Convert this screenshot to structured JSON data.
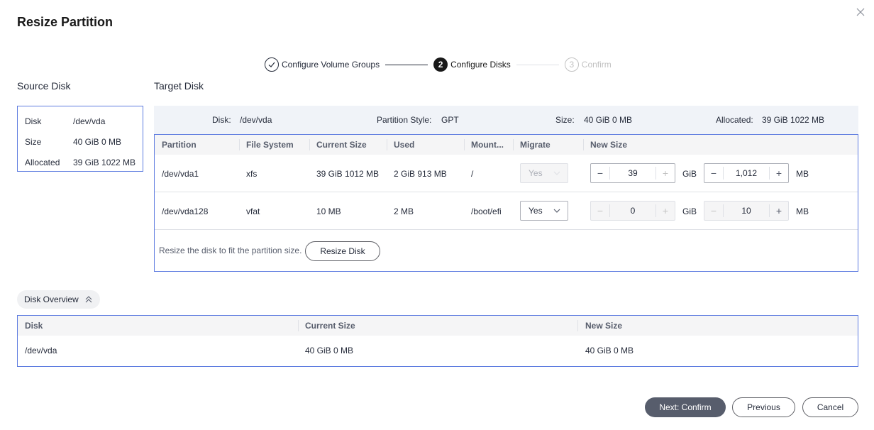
{
  "dialog": {
    "title": "Resize Partition"
  },
  "stepper": [
    {
      "num": "",
      "label": "Configure Volume Groups",
      "state": "done"
    },
    {
      "num": "2",
      "label": "Configure Disks",
      "state": "active"
    },
    {
      "num": "3",
      "label": "Confirm",
      "state": "todo"
    }
  ],
  "source": {
    "section_label": "Source Disk",
    "rows": [
      {
        "key": "Disk",
        "value": "/dev/vda"
      },
      {
        "key": "Size",
        "value": "40 GiB 0 MB"
      },
      {
        "key": "Allocated",
        "value": "39 GiB 1022 MB"
      }
    ]
  },
  "target": {
    "section_label": "Target Disk",
    "header": {
      "disk_label": "Disk:",
      "disk_value": "/dev/vda",
      "style_label": "Partition Style:",
      "style_value": "GPT",
      "size_label": "Size:",
      "size_value": "40 GiB 0 MB",
      "alloc_label": "Allocated:",
      "alloc_value": "39 GiB 1022 MB"
    },
    "columns": [
      "Partition",
      "File System",
      "Current Size",
      "Used",
      "Mount...",
      "Migrate",
      "New Size"
    ],
    "rows": [
      {
        "partition": "/dev/vda1",
        "fs": "xfs",
        "current": "39 GiB 1012 MB",
        "used": "2 GiB 913 MB",
        "mount": "/",
        "migrate": "Yes",
        "gib": "39",
        "gib_unit": "GiB",
        "mb": "1,012",
        "mb_unit": "MB"
      },
      {
        "partition": "/dev/vda128",
        "fs": "vfat",
        "current": "10 MB",
        "used": "2 MB",
        "mount": "/boot/efi",
        "migrate": "Yes",
        "gib": "0",
        "gib_unit": "GiB",
        "mb": "10",
        "mb_unit": "MB"
      }
    ],
    "resize_note": "Resize the disk to fit the partition size.",
    "resize_button": "Resize Disk"
  },
  "overview": {
    "toggle_label": "Disk Overview",
    "columns": [
      "Disk",
      "Current Size",
      "New Size"
    ],
    "row": {
      "disk": "/dev/vda",
      "current": "40 GiB 0 MB",
      "new": "40 GiB 0 MB"
    }
  },
  "footer": {
    "next_label": "Next: Confirm",
    "previous_label": "Previous",
    "cancel_label": "Cancel"
  },
  "colors": {
    "accent_border": "#5e7ce0",
    "primary_button": "#575d6c",
    "header_bg": "#f0f3f8"
  }
}
